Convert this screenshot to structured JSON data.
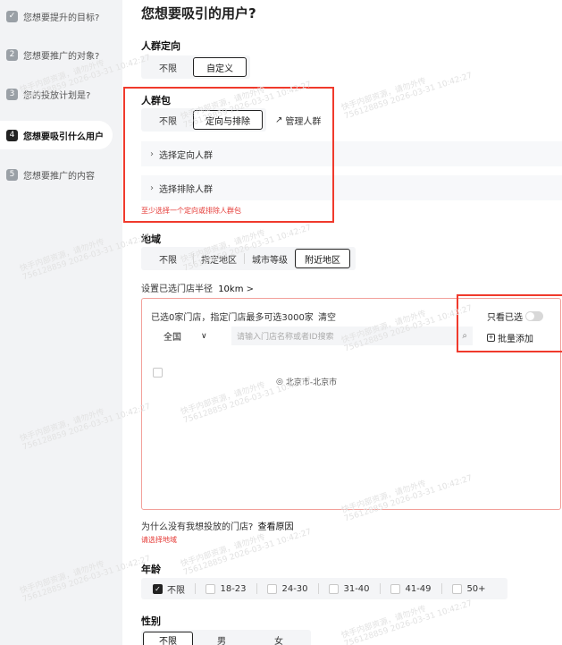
{
  "sidebar": {
    "steps": [
      {
        "num": "✓",
        "label": "您想要提升的目标?"
      },
      {
        "num": "2",
        "label": "您想要推广的对象?"
      },
      {
        "num": "3",
        "label": "您的投放计划是?"
      },
      {
        "num": "4",
        "label": "您想要吸引什么用户"
      },
      {
        "num": "5",
        "label": "您想要推广的内容"
      }
    ]
  },
  "main": {
    "title": "您想要吸引的用户?",
    "crowd_targeting": {
      "title": "人群定向",
      "options": [
        "不限",
        "自定义"
      ],
      "selected": "自定义"
    },
    "crowd_pack": {
      "title": "人群包",
      "options": [
        "不限",
        "定向与排除"
      ],
      "selected": "定向与排除",
      "manage_label": "管理人群",
      "select_target": "选择定向人群",
      "select_exclude": "选择排除人群",
      "error": "至少选择一个定向或排除人群包"
    },
    "region": {
      "title": "地域",
      "options": [
        "不限",
        "指定地区",
        "城市等级",
        "附近地区"
      ],
      "selected": "附近地区",
      "radius_label": "设置已选门店半径",
      "radius_value": "10km",
      "radius_arrow": ">"
    },
    "store": {
      "status_text": "已选0家门店，指定门店最多可选3000家",
      "clear_label": "清空",
      "only_selected_label": "只看已选",
      "batch_add_label": "批量添加",
      "scope_value": "全国",
      "search_placeholder": "请输入门店名称或者ID搜索",
      "location": "北京市-北京市"
    },
    "why_no_store": "为什么没有我想投放的门店?",
    "view_reason": "查看原因",
    "select_region_error": "请选择地域",
    "age": {
      "title": "年龄",
      "options": [
        "不限",
        "18-23",
        "24-30",
        "31-40",
        "41-49",
        "50+"
      ],
      "checked": [
        "不限"
      ]
    },
    "gender": {
      "title": "性别",
      "options": [
        "不限",
        "男",
        "女"
      ],
      "selected": "不限"
    }
  },
  "watermark": {
    "line1": "快手内部资源，请勿外传",
    "line2": "756128859 2026-03-31 10:42:27"
  },
  "colors": {
    "error_red": "#e53935",
    "highlight_red": "#f03a2c",
    "sidebar_bg": "#f2f3f5"
  }
}
